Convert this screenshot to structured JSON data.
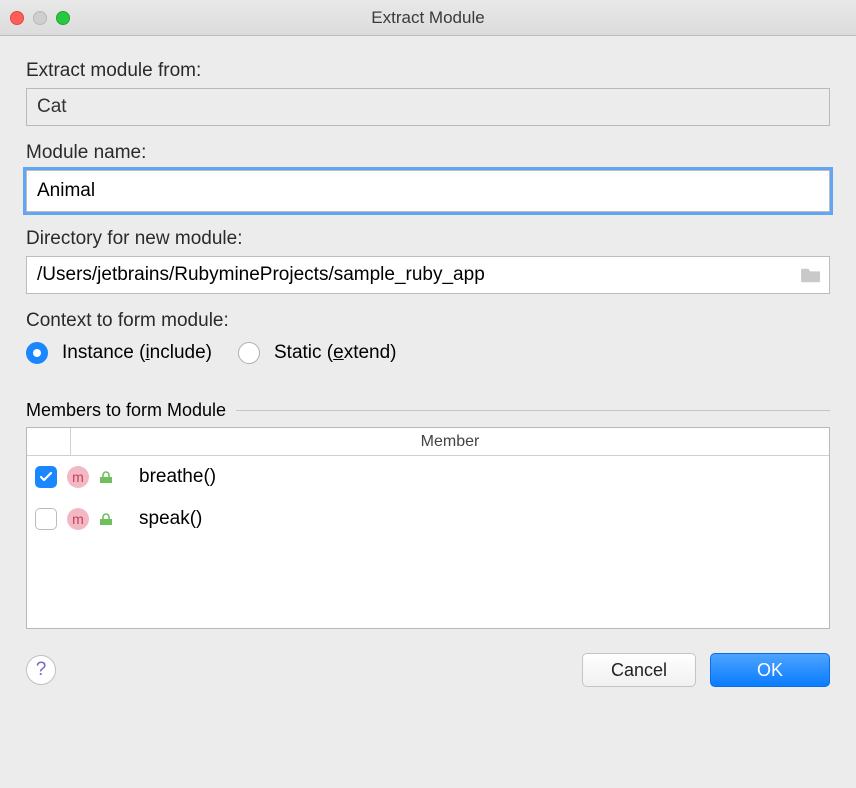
{
  "window": {
    "title": "Extract Module"
  },
  "labels": {
    "extract_from": "Extract module from:",
    "module_name": "Module name:",
    "directory": "Directory for new module:",
    "context": "Context to form module:",
    "members": "Members to form Module"
  },
  "fields": {
    "extract_from_value": "Cat",
    "module_name_value": "Animal",
    "directory_value": "/Users/jetbrains/RubymineProjects/sample_ruby_app"
  },
  "context_options": {
    "instance_prefix": "Instance (",
    "instance_u": "i",
    "instance_suffix": "nclude)",
    "static_prefix": "Static (",
    "static_u": "e",
    "static_suffix": "xtend)",
    "selected": "instance"
  },
  "table": {
    "header": "Member",
    "rows": [
      {
        "checked": true,
        "name": "breathe()"
      },
      {
        "checked": false,
        "name": "speak()"
      }
    ]
  },
  "buttons": {
    "cancel": "Cancel",
    "ok": "OK",
    "help": "?"
  }
}
